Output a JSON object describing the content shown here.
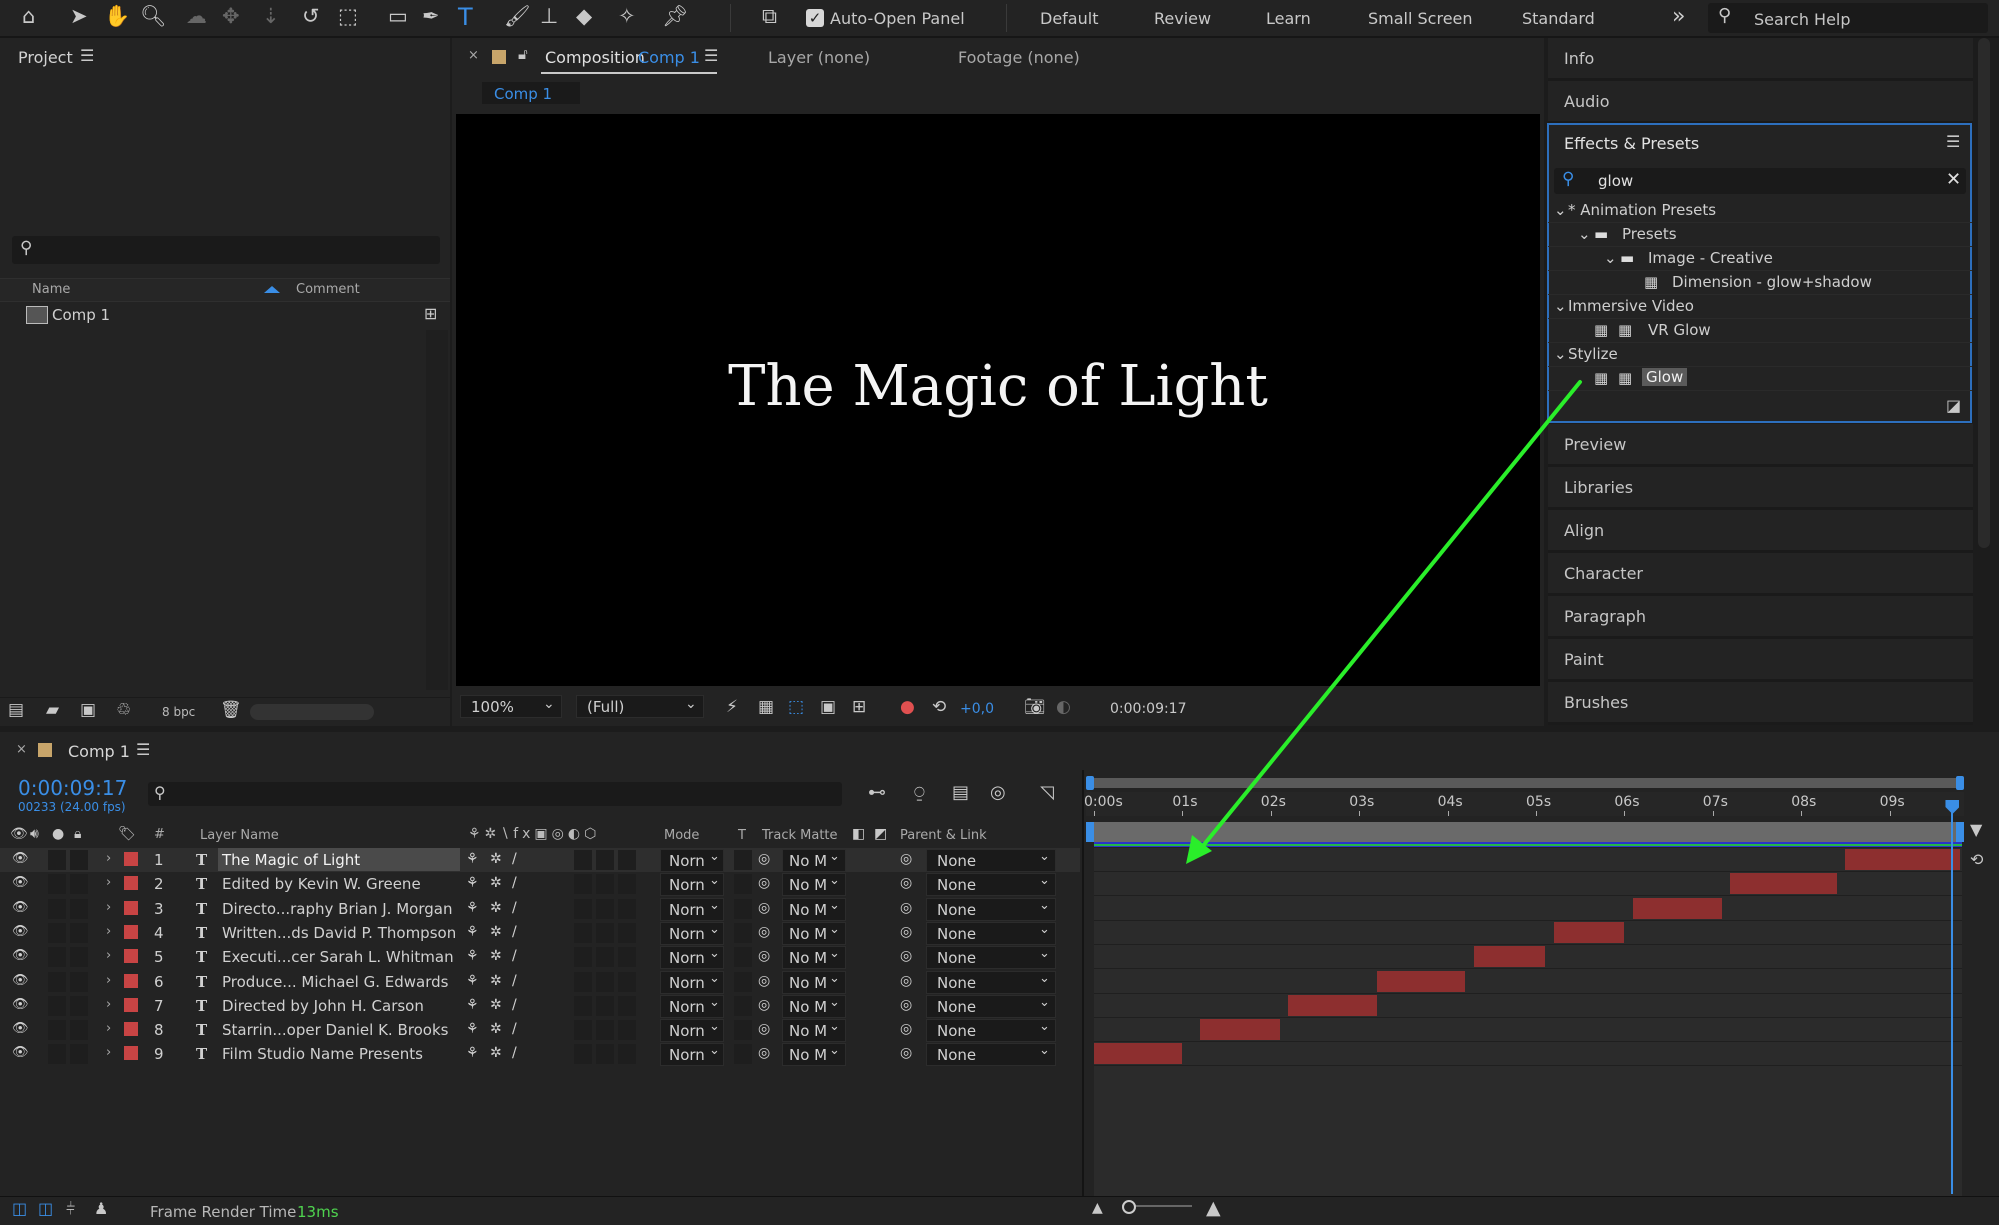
{
  "toolbar": {
    "auto_open_label": "Auto-Open Panel",
    "workspaces": [
      "Default",
      "Review",
      "Learn",
      "Small Screen",
      "Standard"
    ],
    "search_placeholder": "Search Help",
    "more": "»"
  },
  "project": {
    "title": "Project",
    "col_name": "Name",
    "col_comment": "Comment",
    "items": [
      {
        "label": "Comp 1"
      }
    ],
    "bpc": "8 bpc"
  },
  "viewer": {
    "tab_composition_prefix": "Composition",
    "tab_composition_name": "Comp 1",
    "tab_layer": "Layer (none)",
    "tab_footage": "Footage (none)",
    "breadcrumb": "Comp 1",
    "canvas_text": "The Magic of Light",
    "zoom": "100%",
    "resolution": "(Full)",
    "exposure": "+0,0",
    "timecode": "0:00:09:17"
  },
  "right_panels": {
    "info": "Info",
    "audio": "Audio",
    "effects_title": "Effects & Presets",
    "search_value": "glow",
    "tree": [
      {
        "label": "* Animation Presets",
        "level": 0,
        "kind": "group"
      },
      {
        "label": "Presets",
        "level": 1,
        "kind": "folder"
      },
      {
        "label": "Image - Creative",
        "level": 2,
        "kind": "folder"
      },
      {
        "label": "Dimension - glow+shadow",
        "level": 3,
        "kind": "preset"
      },
      {
        "label": "Immersive Video",
        "level": 0,
        "kind": "group"
      },
      {
        "label": "VR Glow",
        "level": 1,
        "kind": "effect"
      },
      {
        "label": "Stylize",
        "level": 0,
        "kind": "group"
      },
      {
        "label": "Glow",
        "level": 1,
        "kind": "effect",
        "selected": true
      }
    ],
    "collapsed": [
      "Preview",
      "Libraries",
      "Align",
      "Character",
      "Paragraph",
      "Paint",
      "Brushes"
    ]
  },
  "timeline": {
    "comp_tab": "Comp 1",
    "timecode": "0:00:09:17",
    "frame_info": "00233 (24.00 fps)",
    "headers": {
      "num": "#",
      "layer_name": "Layer Name",
      "mode": "Mode",
      "t": "T",
      "track_matte": "Track Matte",
      "parent": "Parent & Link"
    },
    "ruler": [
      "0:00s",
      "01s",
      "02s",
      "03s",
      "04s",
      "05s",
      "06s",
      "07s",
      "08s",
      "09s"
    ],
    "layers": [
      {
        "num": "1",
        "name": "The Magic of Light",
        "mode": "Norn",
        "matte": "No M",
        "parent": "None",
        "bar_start": 8.5,
        "bar_end": 9.8
      },
      {
        "num": "2",
        "name": "Edited by  Kevin W. Greene",
        "mode": "Norn",
        "matte": "No M",
        "parent": "None",
        "bar_start": 7.2,
        "bar_end": 8.4
      },
      {
        "num": "3",
        "name": "Directo...raphy  Brian J. Morgan",
        "mode": "Norn",
        "matte": "No M",
        "parent": "None",
        "bar_start": 6.1,
        "bar_end": 7.1
      },
      {
        "num": "4",
        "name": "Written...ds David P. Thompson",
        "mode": "Norn",
        "matte": "No M",
        "parent": "None",
        "bar_start": 5.2,
        "bar_end": 6.0
      },
      {
        "num": "5",
        "name": "Executi...cer  Sarah L. Whitman",
        "mode": "Norn",
        "matte": "No M",
        "parent": "None",
        "bar_start": 4.3,
        "bar_end": 5.1
      },
      {
        "num": "6",
        "name": "Produce...  Michael G. Edwards",
        "mode": "Norn",
        "matte": "No M",
        "parent": "None",
        "bar_start": 3.2,
        "bar_end": 4.2
      },
      {
        "num": "7",
        "name": "Directed by  John H. Carson",
        "mode": "Norn",
        "matte": "No M",
        "parent": "None",
        "bar_start": 2.2,
        "bar_end": 3.2
      },
      {
        "num": "8",
        "name": "Starrin...oper Daniel K. Brooks",
        "mode": "Norn",
        "matte": "No M",
        "parent": "None",
        "bar_start": 1.2,
        "bar_end": 2.1
      },
      {
        "num": "9",
        "name": "Film Studio Name Presents",
        "mode": "Norn",
        "matte": "No M",
        "parent": "None",
        "bar_start": 0.0,
        "bar_end": 1.0
      }
    ],
    "playhead_seconds": 9.7,
    "duration_seconds": 9.96
  },
  "status": {
    "label": "Frame Render Time",
    "value": "13ms"
  },
  "colors": {
    "accent": "#3a8ee6",
    "label_red": "#c84444",
    "bar_red": "#8d2f2f",
    "annotation_arrow": "#2aee2a",
    "panel_bg": "#232323"
  }
}
